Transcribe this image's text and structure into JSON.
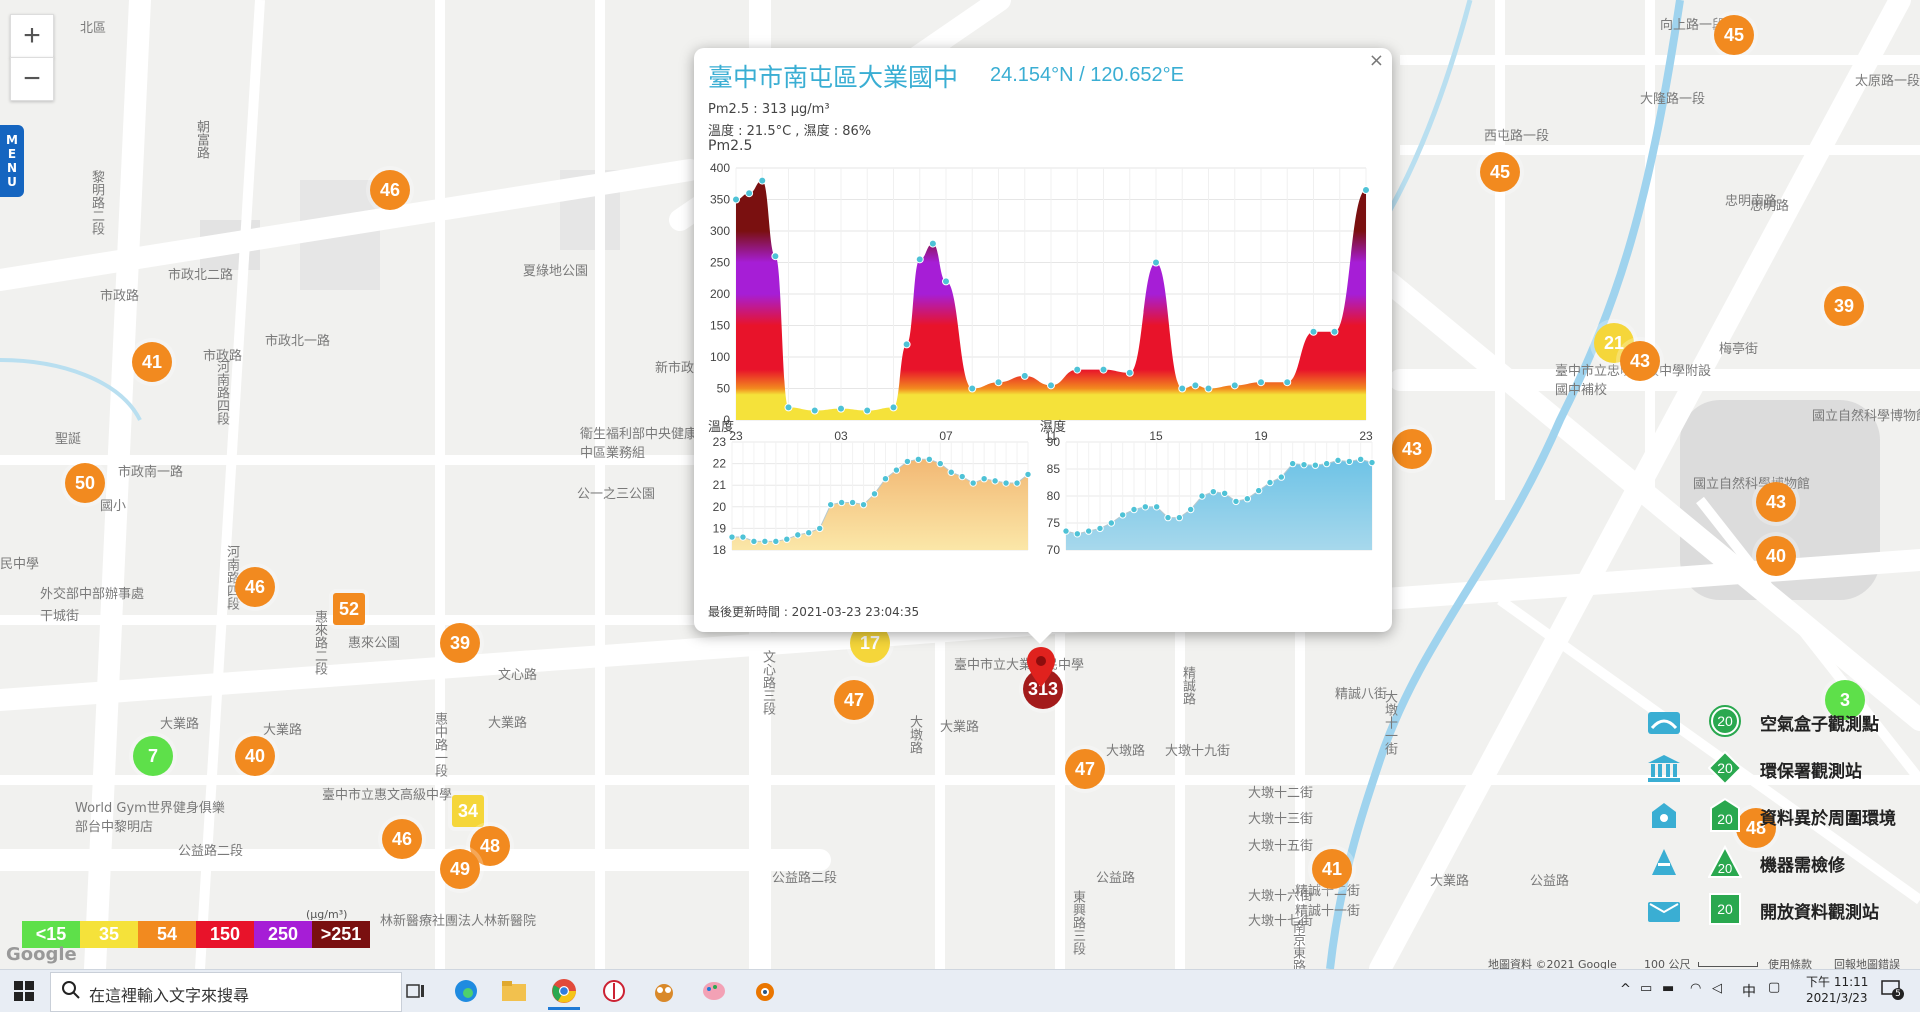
{
  "map": {
    "zoom_in": "+",
    "zoom_out": "−",
    "menu_label": "MENU",
    "street_labels": [
      {
        "text": "北區",
        "t": "h"
      },
      {
        "text": "忠明南路",
        "t": "h"
      },
      {
        "text": "向上路一段",
        "t": "h"
      },
      {
        "text": "市政北二路",
        "t": "h"
      },
      {
        "text": "夏綠地公園",
        "t": "h"
      },
      {
        "text": "市政路",
        "t": "h"
      },
      {
        "text": "市政北一路",
        "t": "h"
      },
      {
        "text": "市政路",
        "t": "h"
      },
      {
        "text": "衛生福利部中央健康保險署中區業務組",
        "t": "h"
      },
      {
        "text": "公一之三公園",
        "t": "h"
      },
      {
        "text": "新市政",
        "t": "h"
      },
      {
        "text": "市政南一路",
        "t": "h"
      },
      {
        "text": "聖誕",
        "t": "h"
      },
      {
        "text": "國小",
        "t": "h"
      },
      {
        "text": "民中學",
        "t": "h"
      },
      {
        "text": "外交部中部辦事處",
        "t": "h"
      },
      {
        "text": "干城街",
        "t": "h"
      },
      {
        "text": "惠來公園",
        "t": "h"
      },
      {
        "text": "文心路",
        "t": "h"
      },
      {
        "text": "大業路",
        "t": "h"
      },
      {
        "text": "大業路",
        "t": "h"
      },
      {
        "text": "大業路",
        "t": "h"
      },
      {
        "text": "大業路",
        "t": "h"
      },
      {
        "text": "臺中市立惠文高級中學",
        "t": "h"
      },
      {
        "text": "World Gym世界健身俱樂部台中黎明店",
        "t": "h"
      },
      {
        "text": "公益路二段",
        "t": "h"
      },
      {
        "text": "林新醫療社團法人林新醫院",
        "t": "h"
      },
      {
        "text": "公益路二段",
        "t": "h"
      },
      {
        "text": "公益路",
        "t": "h"
      },
      {
        "text": "公益路",
        "t": "h"
      },
      {
        "text": "臺中市立大業國民中學",
        "t": "h"
      },
      {
        "text": "大墩路",
        "t": "h"
      },
      {
        "text": "大業路",
        "t": "h"
      },
      {
        "text": "西屯路一段",
        "t": "h"
      },
      {
        "text": "大隆路一段",
        "t": "h"
      },
      {
        "text": "太原路一段",
        "t": "h"
      },
      {
        "text": "忠明路",
        "t": "h"
      },
      {
        "text": "梅亭街",
        "t": "h"
      },
      {
        "text": "國立自然科學博物館植物園",
        "t": "h"
      },
      {
        "text": "國立自然科學博物館",
        "t": "h"
      },
      {
        "text": "臺中市立忠明高級中學附設國中補校",
        "t": "h"
      },
      {
        "text": "大墩十九街",
        "t": "h"
      },
      {
        "text": "大墩十二街",
        "t": "h"
      },
      {
        "text": "大墩十三街",
        "t": "h"
      },
      {
        "text": "大墩十五街",
        "t": "h"
      },
      {
        "text": "大墩十六街",
        "t": "h"
      },
      {
        "text": "大墩十七街",
        "t": "h"
      },
      {
        "text": "精誠八街",
        "t": "h"
      },
      {
        "text": "精誠十二街",
        "t": "h"
      },
      {
        "text": "精誠十一街",
        "t": "h"
      },
      {
        "text": "黎明路二段",
        "t": "v"
      },
      {
        "text": "朝富路",
        "t": "v"
      },
      {
        "text": "河南路四段",
        "t": "v"
      },
      {
        "text": "河南路四段",
        "t": "v"
      },
      {
        "text": "惠來路二段",
        "t": "v"
      },
      {
        "text": "惠中路一段",
        "t": "v"
      },
      {
        "text": "文心路三段",
        "t": "v"
      },
      {
        "text": "大墩路",
        "t": "v"
      },
      {
        "text": "東興路三段",
        "t": "v"
      },
      {
        "text": "精誠路",
        "t": "v"
      },
      {
        "text": "大墩十一街",
        "t": "v"
      },
      {
        "text": "南京東路",
        "t": "v"
      }
    ],
    "markers": [
      {
        "v": "46",
        "c": "orange"
      },
      {
        "v": "41",
        "c": "orange"
      },
      {
        "v": "50",
        "c": "orange"
      },
      {
        "v": "46",
        "c": "orange"
      },
      {
        "v": "52",
        "c": "orange",
        "sq": true
      },
      {
        "v": "39",
        "c": "orange"
      },
      {
        "v": "40",
        "c": "orange"
      },
      {
        "v": "7",
        "c": "green"
      },
      {
        "v": "34",
        "c": "yellow",
        "sq": true
      },
      {
        "v": "46",
        "c": "orange"
      },
      {
        "v": "48",
        "c": "orange"
      },
      {
        "v": "49",
        "c": "orange"
      },
      {
        "v": "17",
        "c": "yellow"
      },
      {
        "v": "47",
        "c": "orange"
      },
      {
        "v": "47",
        "c": "orange"
      },
      {
        "v": "41",
        "c": "orange"
      },
      {
        "v": "45",
        "c": "orange"
      },
      {
        "v": "45",
        "c": "orange"
      },
      {
        "v": "39",
        "c": "orange"
      },
      {
        "v": "21",
        "c": "yellow"
      },
      {
        "v": "43",
        "c": "orange"
      },
      {
        "v": "43",
        "c": "orange"
      },
      {
        "v": "43",
        "c": "orange"
      },
      {
        "v": "40",
        "c": "orange"
      },
      {
        "v": "3",
        "c": "green"
      },
      {
        "v": "48",
        "c": "orange"
      },
      {
        "v": "313",
        "c": "red"
      }
    ],
    "attribution": "地圖資料 ©2021 Google",
    "scale_label": "100 公尺",
    "terms": "使用條款",
    "report": "回報地圖錯誤",
    "google": "Google"
  },
  "popup": {
    "title": "臺中市南屯區大業國中",
    "coords": "24.154°N / 120.652°E",
    "close": "×",
    "pm_line": "Pm2.5 : 313 μg/m³",
    "temp_line": "溫度 : 21.5°C , 濕度 : 86%",
    "pm_title": "Pm2.5",
    "updated": "最後更新時間 : 2021-03-23 23:04:35",
    "temp_title": "溫度",
    "hum_title": "濕度"
  },
  "chart_data": [
    {
      "type": "area",
      "title": "Pm2.5",
      "categories": [
        "23",
        "03",
        "07",
        "11",
        "15",
        "19",
        "23"
      ],
      "ylim": [
        0,
        400
      ],
      "yticks": [
        0,
        50,
        100,
        150,
        200,
        250,
        300,
        350,
        400
      ],
      "x": [
        0,
        0.5,
        1,
        1.5,
        2,
        3,
        4,
        5,
        6,
        6.5,
        7,
        7.5,
        8,
        9,
        10,
        11,
        12,
        13,
        14,
        15,
        16,
        17,
        17.5,
        18,
        19,
        20,
        21,
        22,
        22.8,
        24
      ],
      "values": [
        350,
        360,
        380,
        260,
        20,
        15,
        18,
        15,
        20,
        120,
        255,
        280,
        220,
        50,
        60,
        70,
        55,
        80,
        80,
        75,
        250,
        50,
        55,
        50,
        55,
        60,
        60,
        140,
        140,
        365
      ]
    },
    {
      "type": "area",
      "title": "溫度",
      "ylim": [
        18,
        23
      ],
      "yticks": [
        18,
        19,
        20,
        21,
        22,
        23
      ],
      "values": [
        18.6,
        18.6,
        18.4,
        18.4,
        18.4,
        18.5,
        18.7,
        18.8,
        19.0,
        20.1,
        20.2,
        20.2,
        20.1,
        20.6,
        21.3,
        21.7,
        22.1,
        22.2,
        22.2,
        22.0,
        21.6,
        21.4,
        21.1,
        21.3,
        21.2,
        21.1,
        21.1,
        21.5
      ]
    },
    {
      "type": "area",
      "title": "濕度",
      "ylim": [
        70,
        90
      ],
      "yticks": [
        70,
        75,
        80,
        85,
        90
      ],
      "values": [
        73.5,
        73,
        73.5,
        74,
        75,
        76.5,
        77.5,
        78,
        78,
        76,
        76,
        77.5,
        80,
        80.8,
        80.5,
        79,
        79.5,
        81,
        82.5,
        83.5,
        86,
        85.8,
        85.7,
        86,
        86.6,
        86.4,
        86.8,
        86.2
      ]
    }
  ],
  "legend": {
    "items": [
      {
        "label": "空氣盒子觀測點",
        "mark": "20"
      },
      {
        "label": "環保署觀測站",
        "mark": "20"
      },
      {
        "label": "資料異於周圍環境",
        "mark": "20"
      },
      {
        "label": "機器需檢修",
        "mark": "20"
      },
      {
        "label": "開放資料觀測站",
        "mark": "20"
      }
    ]
  },
  "scale": {
    "unit": "(μg/m³)",
    "bins": [
      {
        "label": "<15",
        "color": "#5ee04a"
      },
      {
        "label": "35",
        "color": "#f5e23a"
      },
      {
        "label": "54",
        "color": "#f28a1f"
      },
      {
        "label": "150",
        "color": "#e8132a"
      },
      {
        "label": "250",
        "color": "#a61ed6"
      },
      {
        "label": ">251",
        "color": "#7a1010"
      }
    ]
  },
  "taskbar": {
    "search_placeholder": "在這裡輸入文字來搜尋",
    "time": "下午 11:11",
    "date": "2021/3/23",
    "ime": "中",
    "notif_count": "5"
  }
}
